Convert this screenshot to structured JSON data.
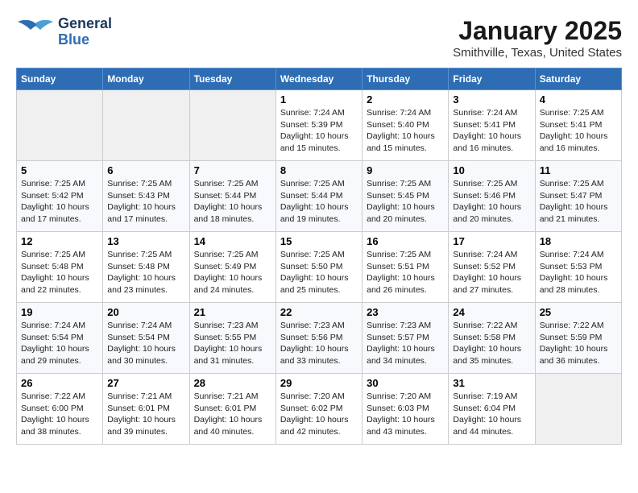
{
  "header": {
    "logo_general": "General",
    "logo_blue": "Blue",
    "month_title": "January 2025",
    "location": "Smithville, Texas, United States"
  },
  "days_of_week": [
    "Sunday",
    "Monday",
    "Tuesday",
    "Wednesday",
    "Thursday",
    "Friday",
    "Saturday"
  ],
  "weeks": [
    [
      {
        "day": "",
        "info": ""
      },
      {
        "day": "",
        "info": ""
      },
      {
        "day": "",
        "info": ""
      },
      {
        "day": "1",
        "info": "Sunrise: 7:24 AM\nSunset: 5:39 PM\nDaylight: 10 hours\nand 15 minutes."
      },
      {
        "day": "2",
        "info": "Sunrise: 7:24 AM\nSunset: 5:40 PM\nDaylight: 10 hours\nand 15 minutes."
      },
      {
        "day": "3",
        "info": "Sunrise: 7:24 AM\nSunset: 5:41 PM\nDaylight: 10 hours\nand 16 minutes."
      },
      {
        "day": "4",
        "info": "Sunrise: 7:25 AM\nSunset: 5:41 PM\nDaylight: 10 hours\nand 16 minutes."
      }
    ],
    [
      {
        "day": "5",
        "info": "Sunrise: 7:25 AM\nSunset: 5:42 PM\nDaylight: 10 hours\nand 17 minutes."
      },
      {
        "day": "6",
        "info": "Sunrise: 7:25 AM\nSunset: 5:43 PM\nDaylight: 10 hours\nand 17 minutes."
      },
      {
        "day": "7",
        "info": "Sunrise: 7:25 AM\nSunset: 5:44 PM\nDaylight: 10 hours\nand 18 minutes."
      },
      {
        "day": "8",
        "info": "Sunrise: 7:25 AM\nSunset: 5:44 PM\nDaylight: 10 hours\nand 19 minutes."
      },
      {
        "day": "9",
        "info": "Sunrise: 7:25 AM\nSunset: 5:45 PM\nDaylight: 10 hours\nand 20 minutes."
      },
      {
        "day": "10",
        "info": "Sunrise: 7:25 AM\nSunset: 5:46 PM\nDaylight: 10 hours\nand 20 minutes."
      },
      {
        "day": "11",
        "info": "Sunrise: 7:25 AM\nSunset: 5:47 PM\nDaylight: 10 hours\nand 21 minutes."
      }
    ],
    [
      {
        "day": "12",
        "info": "Sunrise: 7:25 AM\nSunset: 5:48 PM\nDaylight: 10 hours\nand 22 minutes."
      },
      {
        "day": "13",
        "info": "Sunrise: 7:25 AM\nSunset: 5:48 PM\nDaylight: 10 hours\nand 23 minutes."
      },
      {
        "day": "14",
        "info": "Sunrise: 7:25 AM\nSunset: 5:49 PM\nDaylight: 10 hours\nand 24 minutes."
      },
      {
        "day": "15",
        "info": "Sunrise: 7:25 AM\nSunset: 5:50 PM\nDaylight: 10 hours\nand 25 minutes."
      },
      {
        "day": "16",
        "info": "Sunrise: 7:25 AM\nSunset: 5:51 PM\nDaylight: 10 hours\nand 26 minutes."
      },
      {
        "day": "17",
        "info": "Sunrise: 7:24 AM\nSunset: 5:52 PM\nDaylight: 10 hours\nand 27 minutes."
      },
      {
        "day": "18",
        "info": "Sunrise: 7:24 AM\nSunset: 5:53 PM\nDaylight: 10 hours\nand 28 minutes."
      }
    ],
    [
      {
        "day": "19",
        "info": "Sunrise: 7:24 AM\nSunset: 5:54 PM\nDaylight: 10 hours\nand 29 minutes."
      },
      {
        "day": "20",
        "info": "Sunrise: 7:24 AM\nSunset: 5:54 PM\nDaylight: 10 hours\nand 30 minutes."
      },
      {
        "day": "21",
        "info": "Sunrise: 7:23 AM\nSunset: 5:55 PM\nDaylight: 10 hours\nand 31 minutes."
      },
      {
        "day": "22",
        "info": "Sunrise: 7:23 AM\nSunset: 5:56 PM\nDaylight: 10 hours\nand 33 minutes."
      },
      {
        "day": "23",
        "info": "Sunrise: 7:23 AM\nSunset: 5:57 PM\nDaylight: 10 hours\nand 34 minutes."
      },
      {
        "day": "24",
        "info": "Sunrise: 7:22 AM\nSunset: 5:58 PM\nDaylight: 10 hours\nand 35 minutes."
      },
      {
        "day": "25",
        "info": "Sunrise: 7:22 AM\nSunset: 5:59 PM\nDaylight: 10 hours\nand 36 minutes."
      }
    ],
    [
      {
        "day": "26",
        "info": "Sunrise: 7:22 AM\nSunset: 6:00 PM\nDaylight: 10 hours\nand 38 minutes."
      },
      {
        "day": "27",
        "info": "Sunrise: 7:21 AM\nSunset: 6:01 PM\nDaylight: 10 hours\nand 39 minutes."
      },
      {
        "day": "28",
        "info": "Sunrise: 7:21 AM\nSunset: 6:01 PM\nDaylight: 10 hours\nand 40 minutes."
      },
      {
        "day": "29",
        "info": "Sunrise: 7:20 AM\nSunset: 6:02 PM\nDaylight: 10 hours\nand 42 minutes."
      },
      {
        "day": "30",
        "info": "Sunrise: 7:20 AM\nSunset: 6:03 PM\nDaylight: 10 hours\nand 43 minutes."
      },
      {
        "day": "31",
        "info": "Sunrise: 7:19 AM\nSunset: 6:04 PM\nDaylight: 10 hours\nand 44 minutes."
      },
      {
        "day": "",
        "info": ""
      }
    ]
  ]
}
